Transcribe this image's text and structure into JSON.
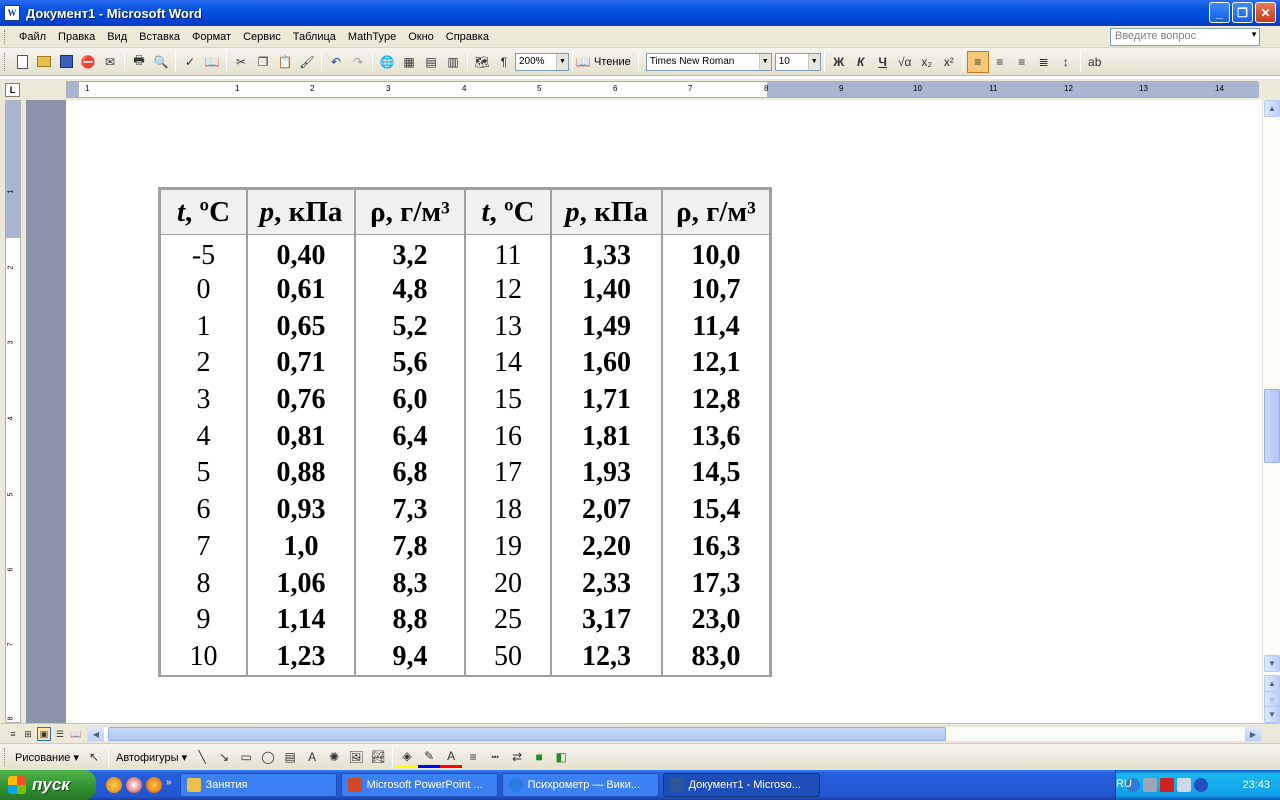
{
  "window": {
    "title": "Документ1 - Microsoft Word",
    "app_icon": "W",
    "controls": {
      "minimize": "_",
      "maximize": "❐",
      "close": "✕"
    }
  },
  "menu": {
    "items": [
      "Файл",
      "Правка",
      "Вид",
      "Вставка",
      "Формат",
      "Сервис",
      "Таблица",
      "MathType",
      "Окно",
      "Справка"
    ],
    "help_placeholder": "Введите вопрос"
  },
  "toolbar": {
    "zoom": "200%",
    "reading_label": "Чтение",
    "font_name": "Times New Roman",
    "font_size": "10",
    "bold_label": "Ж",
    "italic_label": "К",
    "underline_label": "Ч"
  },
  "ruler": {
    "h_numbers": [
      "1",
      "1",
      "2",
      "3",
      "4",
      "5",
      "6",
      "7",
      "8",
      "9",
      "10",
      "11",
      "12",
      "13",
      "14"
    ],
    "v_numbers": [
      "1",
      "2",
      "3",
      "4",
      "5",
      "6",
      "7",
      "8"
    ]
  },
  "table": {
    "headers": [
      {
        "sym": "t",
        "rest": ", ºС"
      },
      {
        "sym": "p",
        "rest": ", кПа"
      },
      {
        "sym": "ρ",
        "rest": ", г/м³"
      },
      {
        "sym": "t",
        "rest": ", ºС"
      },
      {
        "sym": "p",
        "rest": ", кПа"
      },
      {
        "sym": "ρ",
        "rest": ", г/м³"
      }
    ],
    "rows": [
      [
        "-5",
        "0,40",
        "3,2",
        "11",
        "1,33",
        "10,0"
      ],
      [
        "0",
        "0,61",
        "4,8",
        "12",
        "1,40",
        "10,7"
      ],
      [
        "1",
        "0,65",
        "5,2",
        "13",
        "1,49",
        "11,4"
      ],
      [
        "2",
        "0,71",
        "5,6",
        "14",
        "1,60",
        "12,1"
      ],
      [
        "3",
        "0,76",
        "6,0",
        "15",
        "1,71",
        "12,8"
      ],
      [
        "4",
        "0,81",
        "6,4",
        "16",
        "1,81",
        "13,6"
      ],
      [
        "5",
        "0,88",
        "6,8",
        "17",
        "1,93",
        "14,5"
      ],
      [
        "6",
        "0,93",
        "7,3",
        "18",
        "2,07",
        "15,4"
      ],
      [
        "7",
        "1,0",
        "7,8",
        "19",
        "2,20",
        "16,3"
      ],
      [
        "8",
        "1,06",
        "8,3",
        "20",
        "2,33",
        "17,3"
      ],
      [
        "9",
        "1,14",
        "8,8",
        "25",
        "3,17",
        "23,0"
      ],
      [
        "10",
        "1,23",
        "9,4",
        "50",
        "12,3",
        "83,0"
      ]
    ]
  },
  "drawbar": {
    "draw_label": "Рисование ▾",
    "autoshapes_label": "Автофигуры ▾"
  },
  "taskbar": {
    "start_label": "пуск",
    "items": [
      {
        "label": "Занятия",
        "color": "#e8c04a"
      },
      {
        "label": "Microsoft PowerPoint ...",
        "color": "#d24726"
      },
      {
        "label": "Психрометр — Вики...",
        "color": "#2a7ae4"
      },
      {
        "label": "Документ1 - Microso...",
        "color": "#2b579a"
      }
    ],
    "language": "RU",
    "clock": "23:43"
  }
}
